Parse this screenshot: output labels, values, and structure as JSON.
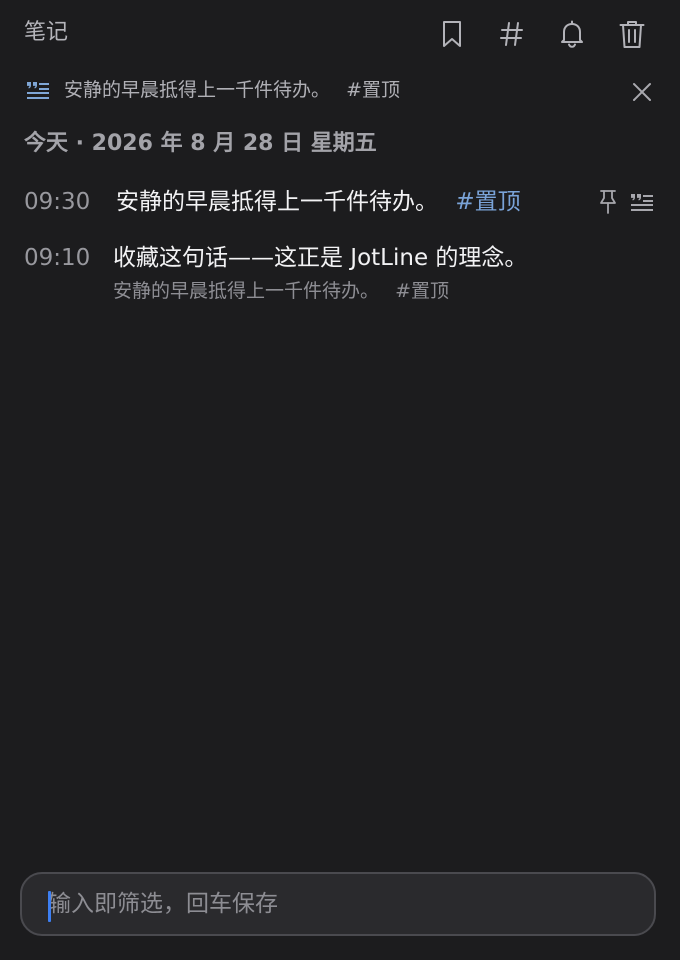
{
  "header": {
    "title": "笔记",
    "actions": [
      {
        "icon": "bookmark-icon"
      },
      {
        "icon": "hashtag-icon"
      },
      {
        "icon": "bell-icon"
      },
      {
        "icon": "trash-icon"
      }
    ]
  },
  "quote_banner": {
    "icon": "quote-list-icon",
    "text": "安静的早晨抵得上一千件待办。",
    "tag": "#置顶",
    "close_icon": "close-icon"
  },
  "date_heading": "今天 · 2026 年 8 月 28 日 星期五",
  "notes": [
    {
      "time": "09:30",
      "text": "安静的早晨抵得上一千件待办。",
      "tag": "#置顶",
      "icons": [
        "pin-icon",
        "quote-list-icon"
      ]
    },
    {
      "time": "09:10",
      "text": "收藏这句话——这正是 JotLine 的理念。",
      "quote_text": "安静的早晨抵得上一千件待办。",
      "quote_tag": "#置顶"
    }
  ],
  "composer": {
    "placeholder": "输入即筛选，回车保存",
    "value": ""
  },
  "colors": {
    "background": "#1c1c1e",
    "accent": "#7aa3d8",
    "caret": "#3d7ff2"
  }
}
